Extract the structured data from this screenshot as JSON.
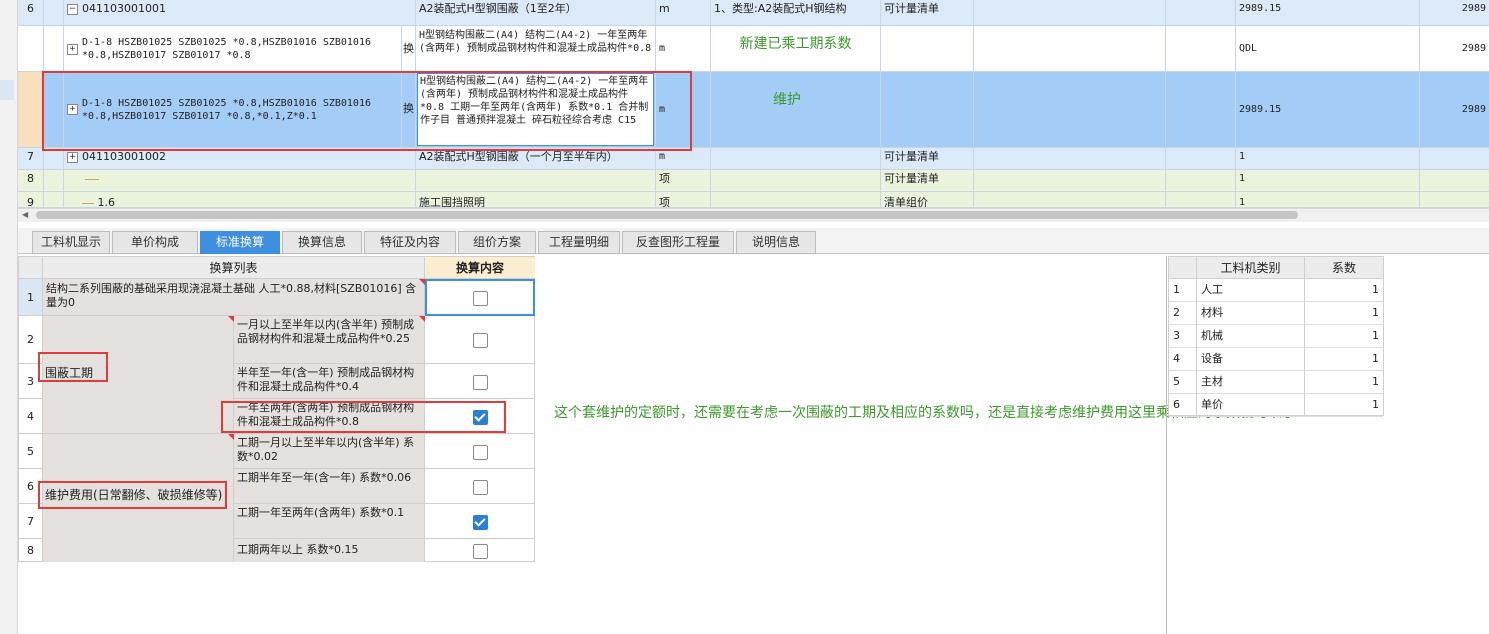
{
  "top_grid": {
    "rows": [
      {
        "num": "6",
        "code": "041103001001",
        "desc": "A2装配式H型钢围蔽（1至2年）",
        "unit": "m",
        "feature": "1、类型:A2装配式H钢结构",
        "type": "可计量清单",
        "qty": "2989.15",
        "last": "2989"
      },
      {
        "num": "",
        "code": "D-1-8 HSZB01025 SZB01025 *0.8,HSZB01016 SZB01016 *0.8,HSZB01017 SZB01017 *0.8",
        "huan": "换",
        "desc": "H型钢结构围蔽二(A4) 结构二(A4-2) 一年至两年(含两年) 预制成品钢材构件和混凝土成品构件*0.8",
        "unit": "m",
        "qty": "QDL",
        "last": "2989"
      },
      {
        "num": "",
        "code": "D-1-8 HSZB01025 SZB01025 *0.8,HSZB01016 SZB01016 *0.8,HSZB01017 SZB01017 *0.8,*0.1,Z*0.1",
        "huan": "换",
        "desc": "H型钢结构围蔽二(A4) 结构二(A4-2) 一年至两年(含两年) 预制成品钢材构件和混凝土成品构件*0.8 工期一年至两年(含两年) 系数*0.1 合并制作子目 普通预拌混凝土 碎石粒径综合考虑 C15",
        "unit": "m",
        "qty": "2989.15",
        "last": "2989"
      },
      {
        "num": "7",
        "code": "041103001002",
        "desc": "A2装配式H型钢围蔽（一个月至半年内）",
        "unit": "m",
        "type": "可计量清单",
        "qty": "1",
        "last": ""
      },
      {
        "num": "8",
        "code": "",
        "desc": "",
        "unit": "项",
        "type": "可计量清单",
        "qty": "1",
        "last": ""
      },
      {
        "num": "9",
        "code": "1.6",
        "desc": "施工围挡照明",
        "unit": "项",
        "type": "清单组价",
        "qty": "1",
        "last": ""
      }
    ],
    "note_new": "新建已乘工期系数",
    "note_maintain": "维护"
  },
  "tabs": [
    "工料机显示",
    "单价构成",
    "标准换算",
    "换算信息",
    "特征及内容",
    "组价方案",
    "工程量明细",
    "反查图形工程量",
    "说明信息"
  ],
  "conv_table": {
    "header_list": "换算列表",
    "header_content": "换算内容",
    "row1_text": "结构二系列围蔽的基础采用现浇混凝土基础 人工*0.88,材料[SZB01016] 含量为0",
    "group1_label": "围蔽工期",
    "group2_label": "维护费用(日常翻修、破损维修等)",
    "items": [
      {
        "num": "1",
        "text": "",
        "checked": false
      },
      {
        "num": "2",
        "text": "一月以上至半年以内(含半年) 预制成品钢材构件和混凝土成品构件*0.25",
        "checked": false
      },
      {
        "num": "3",
        "text": "半年至一年(含一年) 预制成品钢材构件和混凝土成品构件*0.4",
        "checked": false
      },
      {
        "num": "4",
        "text": "一年至两年(含两年) 预制成品钢材构件和混凝土成品构件*0.8",
        "checked": true
      },
      {
        "num": "5",
        "text": "工期一月以上至半年以内(含半年) 系数*0.02",
        "checked": false
      },
      {
        "num": "6",
        "text": "工期半年至一年(含一年) 系数*0.06",
        "checked": false
      },
      {
        "num": "7",
        "text": "工期一年至两年(含两年) 系数*0.1",
        "checked": true
      },
      {
        "num": "8",
        "text": "工期两年以上 系数*0.15",
        "checked": false
      }
    ]
  },
  "question": "这个套维护的定额时，还需要在考虑一次围蔽的工期及相应的系数吗，还是直接考虑维护费用这里乘相应的系数就可以了",
  "coef_table": {
    "header_type": "工料机类别",
    "header_coef": "系数",
    "rows": [
      {
        "num": "1",
        "type": "人工",
        "coef": "1"
      },
      {
        "num": "2",
        "type": "材料",
        "coef": "1"
      },
      {
        "num": "3",
        "type": "机械",
        "coef": "1"
      },
      {
        "num": "4",
        "type": "设备",
        "coef": "1"
      },
      {
        "num": "5",
        "type": "主材",
        "coef": "1"
      },
      {
        "num": "6",
        "type": "单价",
        "coef": "1"
      }
    ]
  },
  "colors": {
    "accent": "#3e8fe0",
    "highlight": "#a3cdf7",
    "note": "#3c9a2c",
    "annot": "#e23b3b"
  }
}
